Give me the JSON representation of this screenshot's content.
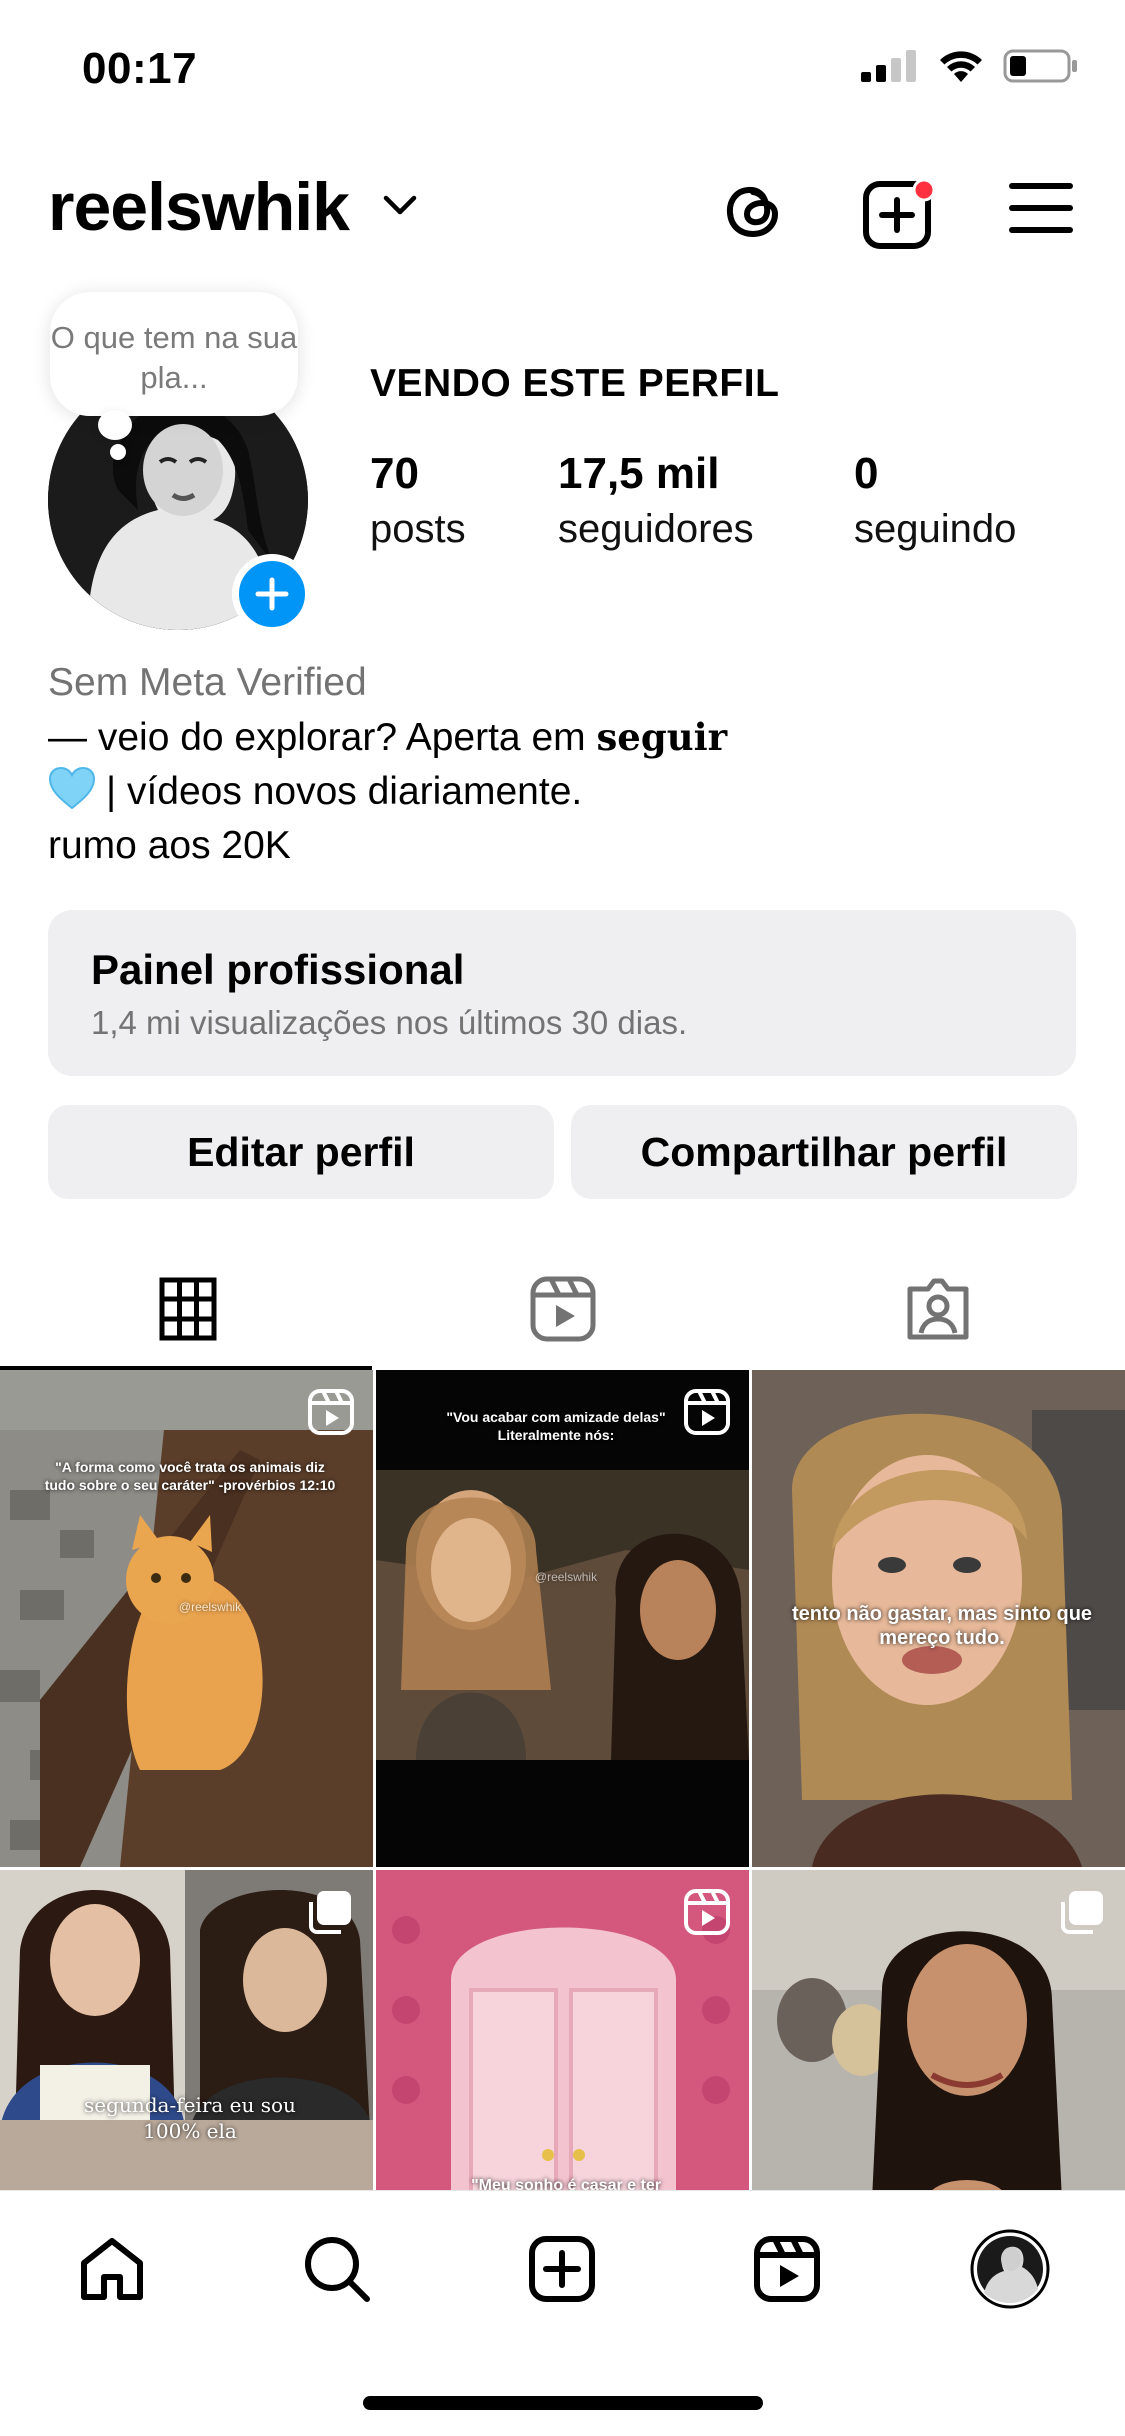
{
  "status_bar": {
    "time": "00:17"
  },
  "header": {
    "username": "reelswhik"
  },
  "profile": {
    "note": "O que tem na sua pla...",
    "name": "VENDO ESTE PERFIL",
    "stats": [
      {
        "value": "70",
        "label": "posts"
      },
      {
        "value": "17,5 mil",
        "label": "seguidores"
      },
      {
        "value": "0",
        "label": "seguindo"
      }
    ],
    "bio": {
      "verified_note": "Sem Meta Verified",
      "line1_prefix": "— veio do explorar? Aperta em",
      "line1_bold": "seguir",
      "line2": "| vídeos novos diariamente.",
      "line3": "rumo aos 20K"
    }
  },
  "professional_panel": {
    "title": "Painel profissional",
    "subtitle": "1,4 mi visualizações nos últimos 30 dias."
  },
  "buttons": {
    "edit": "Editar perfil",
    "share": "Compartilhar perfil"
  },
  "tabs": [
    "grid-icon",
    "reels-icon",
    "tagged-icon"
  ],
  "grid": {
    "posts": [
      {
        "caption": "\"A forma como você trata os animais diz tudo sobre o seu caráter\" -provérbios 12:10",
        "badge": "reel",
        "watermark": "@reelswhik"
      },
      {
        "caption": "\"Vou acabar com amizade delas\" Literalmente nós:",
        "badge": "reel",
        "watermark": "@reelswhik"
      },
      {
        "caption": "tento não gastar, mas sinto que mereço tudo.",
        "badge": "none"
      },
      {
        "caption": "segunda-feira eu sou 100% ela",
        "badge": "carousel"
      },
      {
        "caption": "\"Meu sonho é casar e ter",
        "badge": "reel"
      },
      {
        "caption": "",
        "badge": "carousel"
      }
    ]
  },
  "bottom_nav": [
    "home-icon",
    "search-icon",
    "create-icon",
    "reels-icon",
    "profile-avatar"
  ],
  "colors": {
    "accent": "#0095f6",
    "notification": "#ff3040",
    "panel_bg": "#efeff1",
    "muted_text": "#737373"
  }
}
